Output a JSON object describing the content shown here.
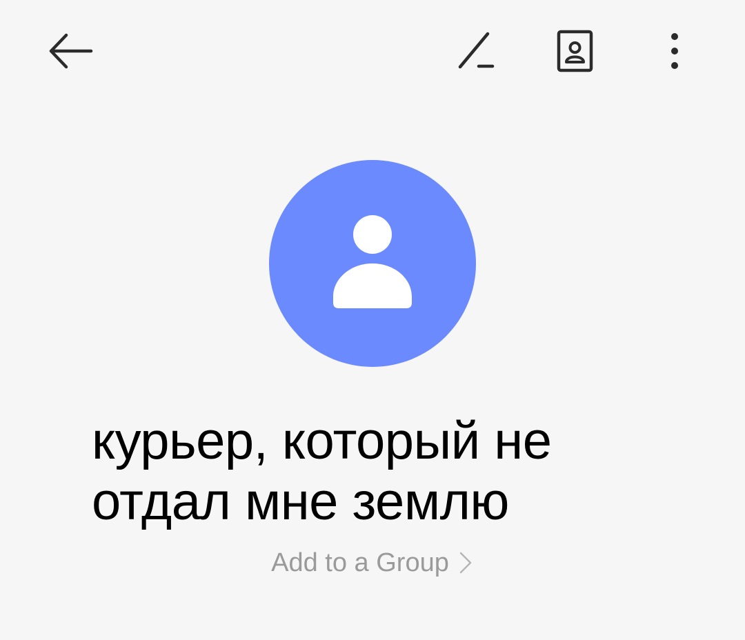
{
  "toolbar": {
    "back_icon": "arrow-left-icon",
    "edit_icon": "pencil-icon",
    "contact_card_icon": "contact-card-icon",
    "more_icon": "more-vertical-icon"
  },
  "contact": {
    "avatar_icon": "person-icon",
    "avatar_color": "#6b8afd",
    "name": "курьер, который не отдал мне землю"
  },
  "group": {
    "label": "Add to a Group",
    "chevron_icon": "chevron-right-icon"
  }
}
